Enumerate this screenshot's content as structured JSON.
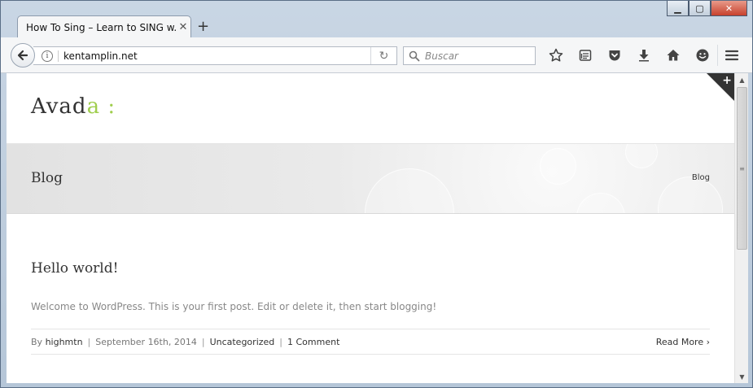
{
  "window": {
    "minimize": "▁",
    "maximize": "▢",
    "close": "✕"
  },
  "tab": {
    "title": "How To Sing – Learn to SING w...",
    "close": "✕",
    "new_tab": "+"
  },
  "toolbar": {
    "url": "kentamplin.net",
    "search_placeholder": "Buscar",
    "reload": "↻"
  },
  "site": {
    "logo_main": "Avad",
    "logo_accent": "a",
    "logo_dots": ":",
    "page_title": "Blog",
    "breadcrumb": "Blog",
    "corner_plus": "+"
  },
  "post": {
    "title": "Hello world!",
    "excerpt": "Welcome to WordPress. This is your first post. Edit or delete it, then start blogging!",
    "by_label": "By",
    "author": "highmtn",
    "date": "September 16th, 2014",
    "category": "Uncategorized",
    "comments": "1 Comment",
    "separator": "|",
    "read_more": "Read More",
    "read_more_arrow": "›"
  },
  "scrollbar": {
    "up": "▲",
    "down": "▼",
    "grip": "≡"
  },
  "colors": {
    "accent": "#a0ce4e",
    "text": "#333333",
    "muted": "#888888"
  }
}
